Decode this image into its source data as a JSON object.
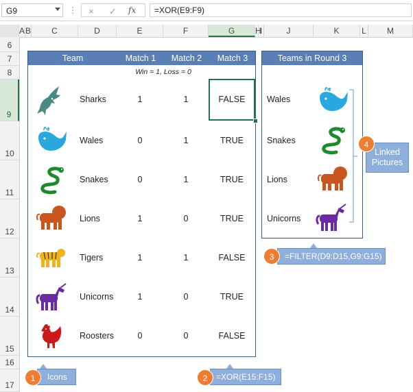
{
  "formula_bar": {
    "name_box": "G9",
    "cancel_icon": "×",
    "enter_icon": "✓",
    "fx_label": "fx",
    "formula": "=XOR(E9:F9)"
  },
  "columns": [
    "A",
    "B",
    "C",
    "D",
    "E",
    "F",
    "G",
    "H",
    "I",
    "J",
    "K",
    "L",
    "M"
  ],
  "selected_column": "G",
  "rows": [
    "6",
    "7",
    "8",
    "9",
    "10",
    "11",
    "12",
    "13",
    "14",
    "15",
    "16",
    "17"
  ],
  "selected_row": "9",
  "match_table": {
    "headers": [
      "Team",
      "Match 1",
      "Match 2",
      "Match 3"
    ],
    "note": "Win = 1, Loss = 0",
    "rows": [
      {
        "icon": "shark-icon",
        "team": "Sharks",
        "m1": "1",
        "m2": "1",
        "m3": "FALSE"
      },
      {
        "icon": "whale-icon",
        "team": "Wales",
        "m1": "0",
        "m2": "1",
        "m3": "TRUE"
      },
      {
        "icon": "snake-icon",
        "team": "Snakes",
        "m1": "0",
        "m2": "1",
        "m3": "TRUE"
      },
      {
        "icon": "lion-icon",
        "team": "Lions",
        "m1": "1",
        "m2": "0",
        "m3": "TRUE"
      },
      {
        "icon": "tiger-icon",
        "team": "Tigers",
        "m1": "1",
        "m2": "1",
        "m3": "FALSE"
      },
      {
        "icon": "unicorn-icon",
        "team": "Unicorns",
        "m1": "1",
        "m2": "0",
        "m3": "TRUE"
      },
      {
        "icon": "rooster-icon",
        "team": "Roosters",
        "m1": "0",
        "m2": "0",
        "m3": "FALSE"
      }
    ]
  },
  "round3_table": {
    "header": "Teams in Round 3",
    "rows": [
      {
        "team": "Wales",
        "icon": "whale-icon"
      },
      {
        "team": "Snakes",
        "icon": "snake-icon"
      },
      {
        "team": "Lions",
        "icon": "lion-icon"
      },
      {
        "team": "Unicorns",
        "icon": "unicorn-icon"
      }
    ]
  },
  "callouts": {
    "c1": {
      "num": "1",
      "text": "Icons"
    },
    "c2": {
      "num": "2",
      "text": "=XOR(E15:F15)"
    },
    "c3": {
      "num": "3",
      "text": "=FILTER(D9:D15,G9:G15)"
    },
    "c4": {
      "num": "4",
      "line1": "Linked",
      "line2": "Pictures"
    }
  },
  "colors": {
    "header_blue": "#5a7fb5",
    "excel_green": "#217346",
    "callout_blue": "#8eaedb",
    "callout_orange": "#ed7d31",
    "shark": "#4a8a84",
    "whale": "#29a8e0",
    "snake": "#1d8a2c",
    "lion": "#c9561e",
    "tiger": "#f2b21b",
    "unicorn": "#6a2aa0",
    "rooster": "#cc1a1a"
  }
}
